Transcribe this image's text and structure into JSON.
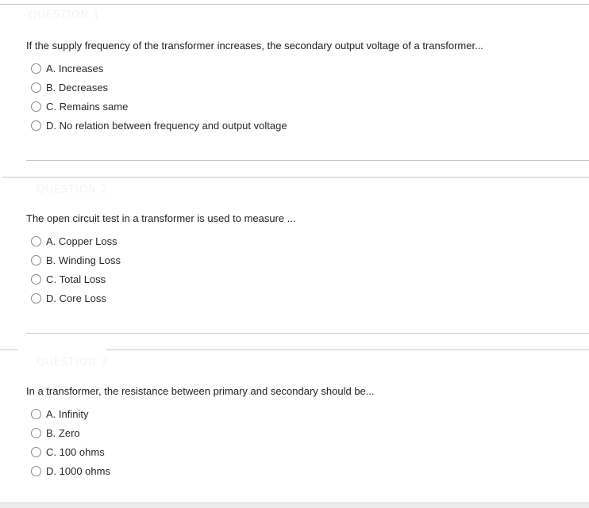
{
  "questions": [
    {
      "label": "QUESTION 1",
      "text": "If the supply frequency of the transformer increases, the secondary output voltage of a transformer...",
      "options": [
        {
          "key": "A.",
          "label": "Increases"
        },
        {
          "key": "B.",
          "label": "Decreases"
        },
        {
          "key": "C.",
          "label": "Remains same"
        },
        {
          "key": "D.",
          "label": "No relation between frequency and output voltage"
        }
      ]
    },
    {
      "label": "QUESTION 2",
      "text": "The open circuit test in a transformer is used to measure ...",
      "options": [
        {
          "key": "A.",
          "label": "Copper Loss"
        },
        {
          "key": "B.",
          "label": "Winding Loss"
        },
        {
          "key": "C.",
          "label": "Total Loss"
        },
        {
          "key": "D.",
          "label": "Core Loss"
        }
      ]
    },
    {
      "label": "QUESTION 3",
      "text": "In a transformer, the resistance between primary and secondary should be...",
      "options": [
        {
          "key": "A.",
          "label": "Infinity"
        },
        {
          "key": "B.",
          "label": "Zero"
        },
        {
          "key": "C.",
          "label": "100 ohms"
        },
        {
          "key": "D.",
          "label": "1000 ohms"
        }
      ]
    }
  ],
  "icons": {
    "radio": "radio-unselected-icon"
  }
}
